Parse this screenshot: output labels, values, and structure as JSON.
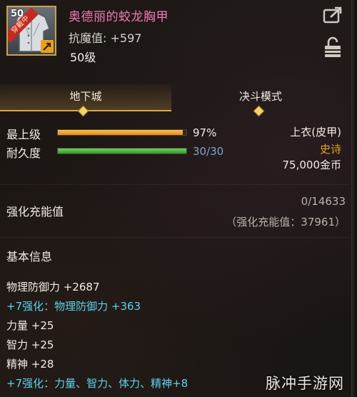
{
  "item": {
    "icon_level": "50",
    "icon_badge": "穿戴中",
    "name": "奥德丽的蛟龙胸甲",
    "magic_resistance": "抗魔值: +597",
    "level": "50级"
  },
  "header_icons": {
    "share": "share-icon",
    "lock": "lock-icon"
  },
  "tabs": [
    {
      "label": "地下城",
      "active": true
    },
    {
      "label": "决斗模式",
      "active": false
    }
  ],
  "grade": {
    "label": "最上级",
    "value": "97%",
    "fill": 0.97,
    "color": "#f0a02a"
  },
  "durability": {
    "label": "耐久度",
    "value": "30/30",
    "fill": 1.0,
    "color": "#49b43a"
  },
  "meta": {
    "type": "上衣(皮甲)",
    "rarity": "史诗",
    "price": "75,000金币",
    "rarity_color": "#e7a023"
  },
  "charge": {
    "label": "强化充能值",
    "value": "0/14633",
    "sub": "（强化充能值：37961）"
  },
  "basic_info": {
    "title": "基本信息",
    "stats": [
      {
        "text": "物理防御力 +2687",
        "highlight": false
      },
      {
        "text": "+7强化：物理防御力 +363",
        "highlight": true
      },
      {
        "text": "力量 +25",
        "highlight": false
      },
      {
        "text": "智力 +25",
        "highlight": false
      },
      {
        "text": "精神 +28",
        "highlight": false
      },
      {
        "text": "+7强化：力量、智力、体力、精神+8",
        "highlight": true
      }
    ]
  },
  "watermark": "脉冲手游网"
}
